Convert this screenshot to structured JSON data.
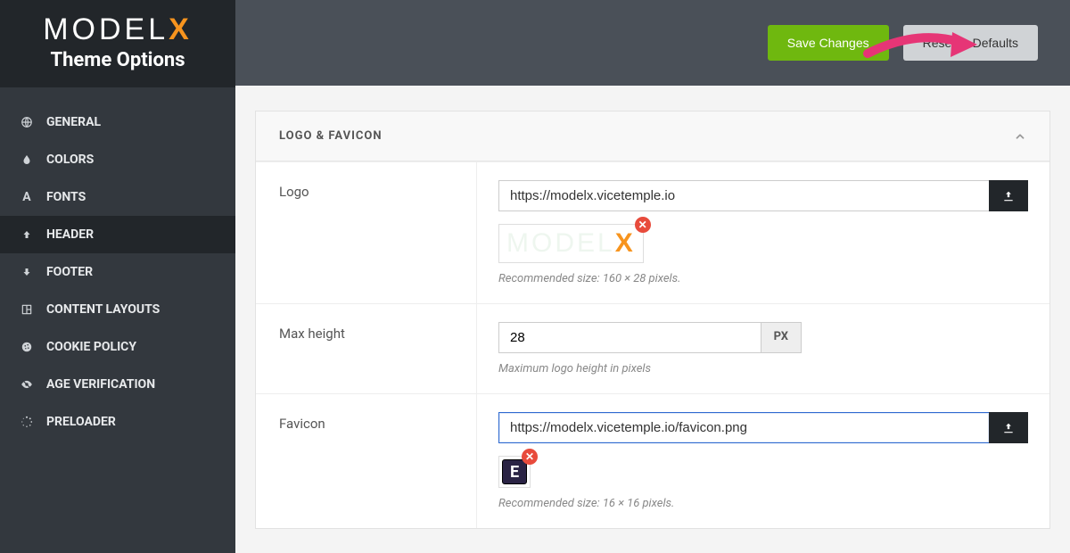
{
  "brand": {
    "name_a": "MODEL",
    "name_b": "X",
    "subtitle": "Theme Options"
  },
  "topbar": {
    "save": "Save Changes",
    "reset": "Reset to Defaults"
  },
  "nav": [
    {
      "icon": "globe",
      "label": "GENERAL"
    },
    {
      "icon": "drop",
      "label": "COLORS"
    },
    {
      "icon": "font",
      "label": "FONTS"
    },
    {
      "icon": "up",
      "label": "HEADER",
      "active": true
    },
    {
      "icon": "down",
      "label": "FOOTER"
    },
    {
      "icon": "layout",
      "label": "CONTENT LAYOUTS"
    },
    {
      "icon": "cookie",
      "label": "COOKIE POLICY"
    },
    {
      "icon": "eye",
      "label": "AGE VERIFICATION"
    },
    {
      "icon": "spinner",
      "label": "PRELOADER"
    }
  ],
  "panel": {
    "title": "LOGO & FAVICON",
    "rows": {
      "logo": {
        "label": "Logo",
        "value": "https://modelx.vicetemple.io",
        "hint": "Recommended size: 160 × 28 pixels."
      },
      "maxheight": {
        "label": "Max height",
        "value": "28",
        "suffix": "PX",
        "hint": "Maximum logo height in pixels"
      },
      "favicon": {
        "label": "Favicon",
        "value": "https://modelx.vicetemple.io/favicon.png",
        "hint": "Recommended size: 16 × 16 pixels.",
        "preview_letter": "E"
      }
    }
  }
}
